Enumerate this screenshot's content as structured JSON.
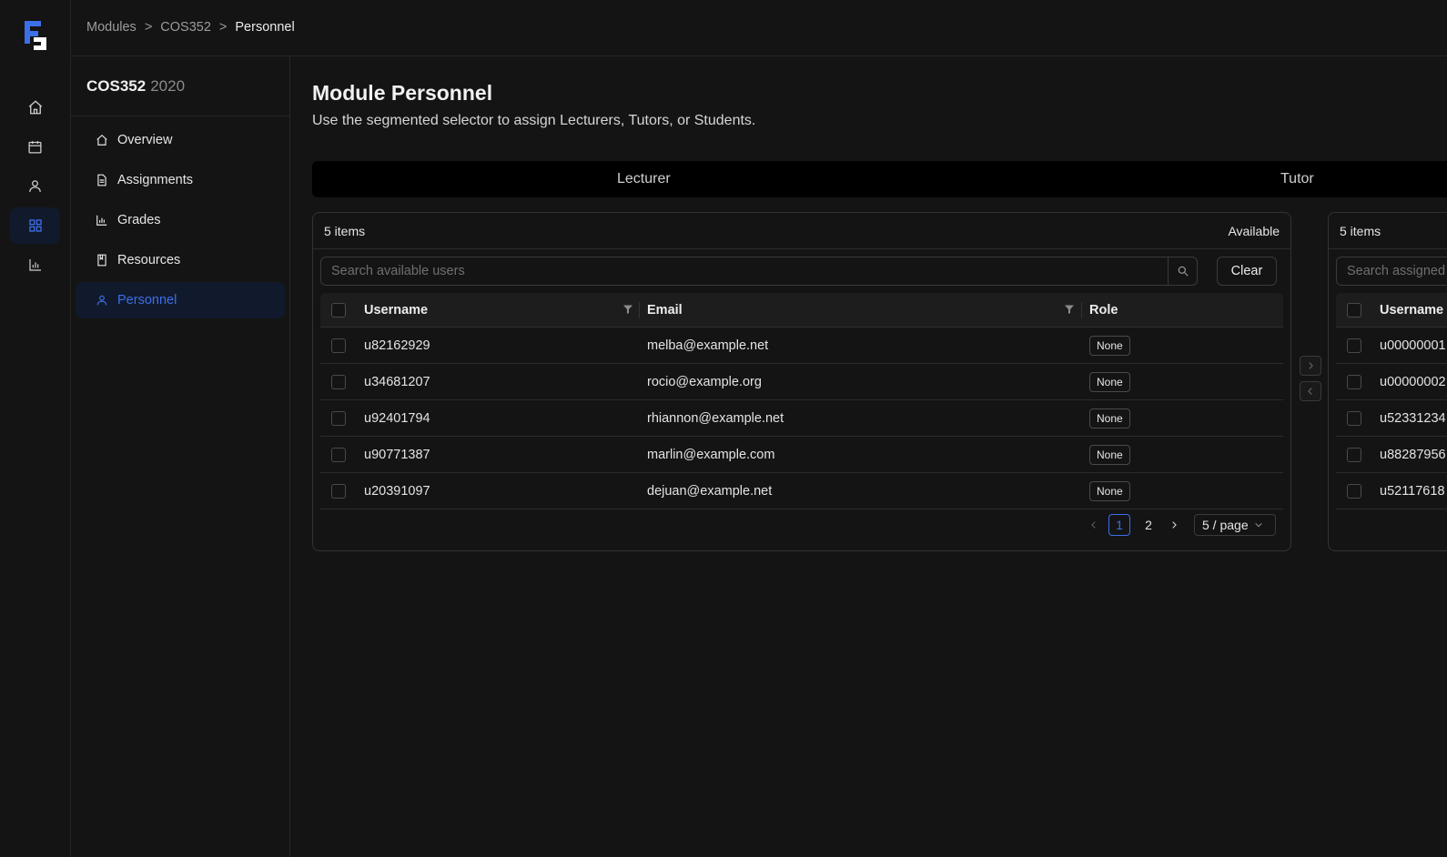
{
  "breadcrumb": {
    "items": [
      "Modules",
      "COS352",
      "Personnel"
    ],
    "separator": ">"
  },
  "rail": {
    "items": [
      {
        "icon": "home-icon"
      },
      {
        "icon": "calendar-icon"
      },
      {
        "icon": "user-icon"
      },
      {
        "icon": "grid-icon",
        "active": true
      },
      {
        "icon": "chart-icon"
      }
    ]
  },
  "module": {
    "code": "COS352",
    "year": "2020",
    "nav": [
      {
        "label": "Overview",
        "icon": "home-icon"
      },
      {
        "label": "Assignments",
        "icon": "document-icon"
      },
      {
        "label": "Grades",
        "icon": "bar-chart-icon"
      },
      {
        "label": "Resources",
        "icon": "book-icon"
      },
      {
        "label": "Personnel",
        "icon": "user-icon",
        "active": true
      }
    ]
  },
  "page": {
    "title": "Module Personnel",
    "subtitle": "Use the segmented selector to assign Lecturers, Tutors, or Students."
  },
  "segments": [
    "Lecturer",
    "Tutor"
  ],
  "available": {
    "count_label": "5 items",
    "title": "Available",
    "search_placeholder": "Search available users",
    "clear_label": "Clear",
    "columns": [
      "Username",
      "Email",
      "Role"
    ],
    "rows": [
      {
        "username": "u82162929",
        "email": "melba@example.net",
        "role": "None"
      },
      {
        "username": "u34681207",
        "email": "rocio@example.org",
        "role": "None"
      },
      {
        "username": "u92401794",
        "email": "rhiannon@example.net",
        "role": "None"
      },
      {
        "username": "u90771387",
        "email": "marlin@example.com",
        "role": "None"
      },
      {
        "username": "u20391097",
        "email": "dejuan@example.net",
        "role": "None"
      }
    ],
    "pagination": {
      "pages": [
        "1",
        "2"
      ],
      "current": "1",
      "page_size": "5 / page"
    }
  },
  "assigned": {
    "count_label": "5 items",
    "search_placeholder": "Search assigned",
    "columns": [
      "Username"
    ],
    "rows": [
      {
        "username": "u00000001"
      },
      {
        "username": "u00000002"
      },
      {
        "username": "u52331234"
      },
      {
        "username": "u88287956"
      },
      {
        "username": "u52117618"
      }
    ]
  },
  "colors": {
    "background": "#141414",
    "accent": "#3c6fe8",
    "active_bg": "#111a2c",
    "border": "#333333"
  }
}
